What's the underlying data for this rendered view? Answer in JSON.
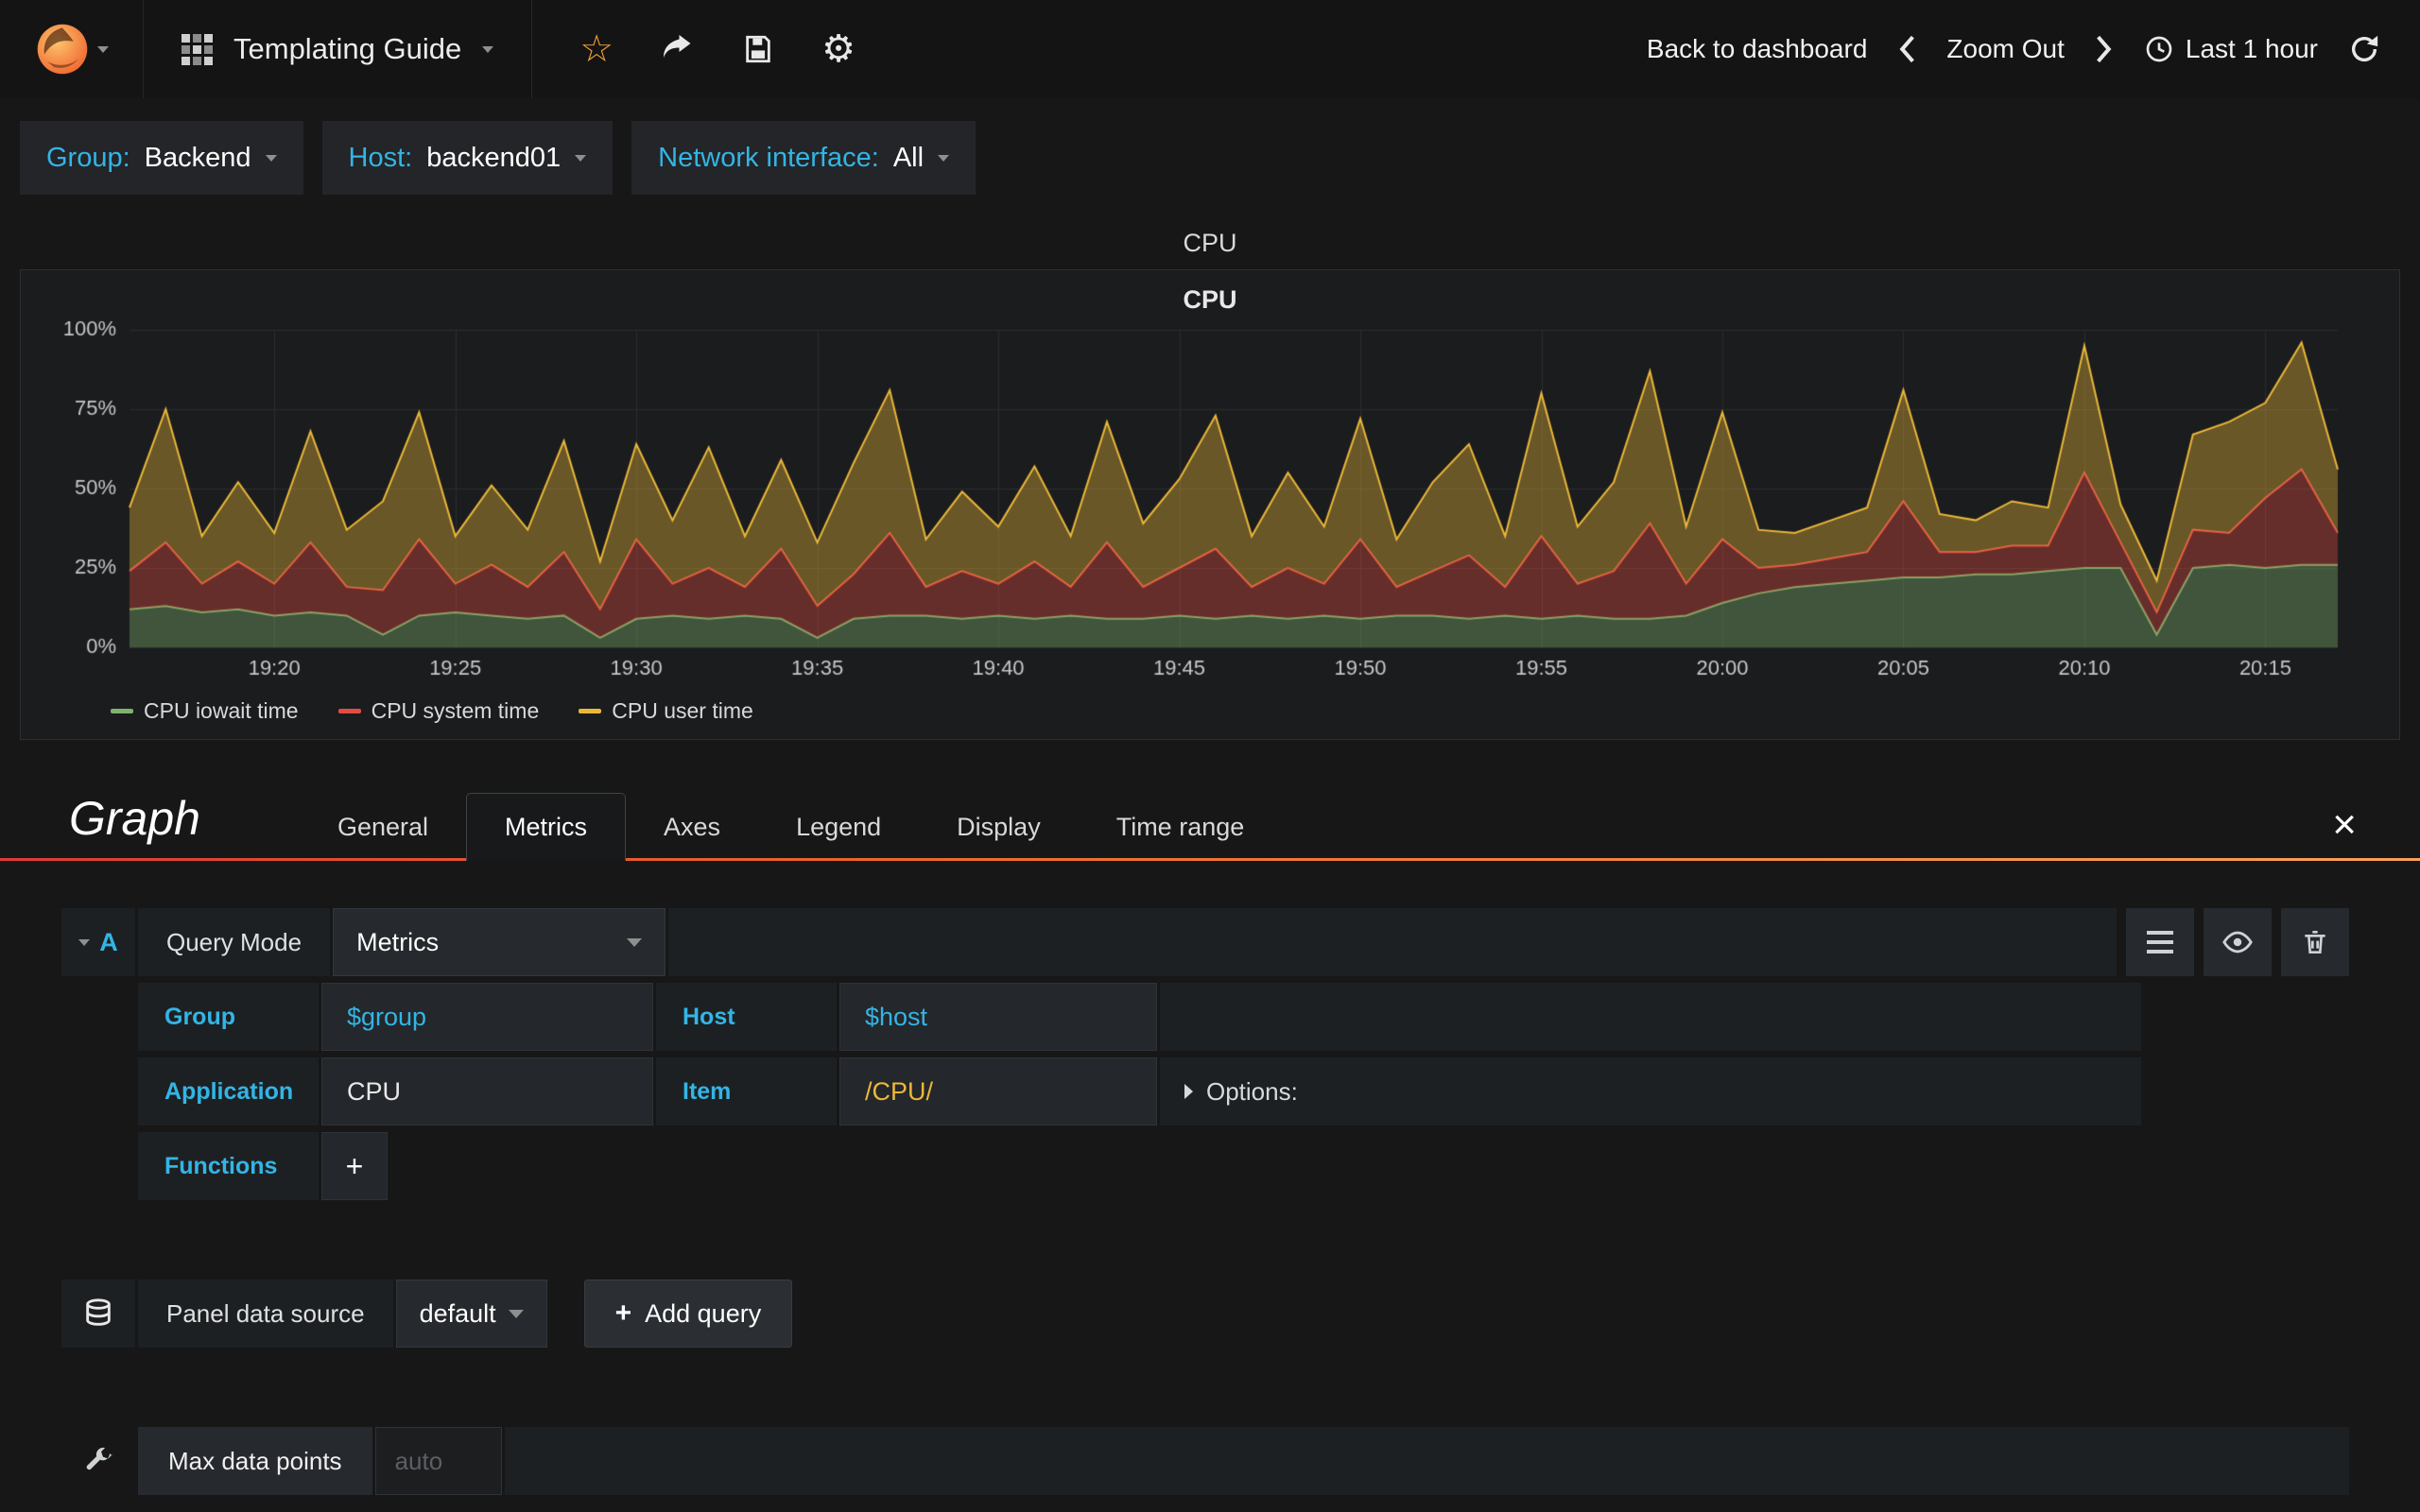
{
  "colors": {
    "accent_blue": "#33B5E5",
    "highlight_yellow": "#EAB839",
    "brand_orange": "#F05A28",
    "series_green": "#7EB26D",
    "series_red": "#E24D42",
    "series_yellow": "#EAB839"
  },
  "icons": {
    "star": "☆",
    "gear": "⚙",
    "close": "×",
    "plus": "+"
  },
  "navbar": {
    "title": "Templating Guide",
    "back_to_dashboard": "Back to dashboard",
    "zoom_out": "Zoom Out",
    "time_range": "Last 1 hour"
  },
  "template_variables": [
    {
      "label": "Group:",
      "value": "Backend"
    },
    {
      "label": "Host:",
      "value": "backend01"
    },
    {
      "label": "Network interface:",
      "value": "All"
    }
  ],
  "panel": {
    "row_title": "CPU",
    "title": "CPU"
  },
  "chart_data": {
    "type": "area",
    "stacked": true,
    "title": "CPU",
    "xlabel": "",
    "ylabel": "",
    "ylim": [
      0,
      100
    ],
    "grid": true,
    "legend_position": "bottom",
    "ytick_values": [
      0,
      25,
      50,
      75,
      100
    ],
    "ytick_labels": [
      "0%",
      "25%",
      "50%",
      "75%",
      "100%"
    ],
    "xtick_labels": [
      "19:20",
      "19:25",
      "19:30",
      "19:35",
      "19:40",
      "19:45",
      "19:50",
      "19:55",
      "20:00",
      "20:05",
      "20:10",
      "20:15"
    ],
    "xtick_indices": [
      4,
      9,
      14,
      19,
      24,
      29,
      34,
      39,
      44,
      49,
      54,
      59
    ],
    "series": [
      {
        "name": "CPU iowait time",
        "color": "#7EB26D",
        "values": [
          12,
          13,
          11,
          12,
          10,
          11,
          10,
          4,
          10,
          11,
          10,
          9,
          10,
          3,
          9,
          10,
          9,
          10,
          9,
          3,
          9,
          10,
          10,
          9,
          10,
          9,
          10,
          9,
          9,
          10,
          9,
          10,
          9,
          10,
          9,
          10,
          10,
          9,
          10,
          9,
          10,
          9,
          9,
          10,
          14,
          17,
          19,
          20,
          21,
          22,
          22,
          23,
          23,
          24,
          25,
          25,
          4,
          25,
          26,
          25,
          26,
          26
        ]
      },
      {
        "name": "CPU system time",
        "color": "#E24D42",
        "values": [
          12,
          20,
          9,
          15,
          10,
          22,
          9,
          14,
          24,
          9,
          16,
          10,
          20,
          9,
          25,
          10,
          16,
          9,
          22,
          10,
          14,
          26,
          9,
          15,
          10,
          18,
          9,
          24,
          10,
          15,
          22,
          9,
          16,
          10,
          25,
          9,
          14,
          20,
          9,
          26,
          10,
          15,
          30,
          10,
          20,
          8,
          7,
          8,
          9,
          24,
          8,
          7,
          9,
          8,
          30,
          8,
          7,
          12,
          10,
          22,
          30,
          10
        ]
      },
      {
        "name": "CPU user time",
        "color": "#EAB839",
        "values": [
          20,
          42,
          15,
          25,
          16,
          35,
          18,
          28,
          40,
          15,
          25,
          18,
          35,
          15,
          30,
          20,
          38,
          16,
          28,
          20,
          35,
          45,
          15,
          25,
          18,
          30,
          16,
          38,
          20,
          28,
          42,
          16,
          30,
          18,
          38,
          15,
          28,
          35,
          16,
          45,
          18,
          28,
          48,
          18,
          40,
          12,
          10,
          12,
          14,
          35,
          12,
          10,
          14,
          12,
          40,
          12,
          10,
          30,
          35,
          30,
          40,
          20
        ]
      }
    ]
  },
  "editor": {
    "panel_type": "Graph",
    "tabs": [
      "General",
      "Metrics",
      "Axes",
      "Legend",
      "Display",
      "Time range"
    ],
    "active_tab": "Metrics",
    "query": {
      "letter": "A",
      "mode_label": "Query Mode",
      "mode_value": "Metrics",
      "fields": [
        {
          "label": "Group",
          "value": "$group"
        },
        {
          "label": "Host",
          "value": "$host"
        },
        {
          "label": "Application",
          "value": "CPU"
        },
        {
          "label": "Item",
          "value": "/CPU/"
        }
      ],
      "options_label": "Options:",
      "functions_label": "Functions",
      "add_function_label": "+"
    },
    "datasource": {
      "label": "Panel data source",
      "value": "default",
      "add_query_label": "Add query"
    },
    "max_data_points": {
      "label": "Max data points",
      "placeholder": "auto"
    }
  }
}
